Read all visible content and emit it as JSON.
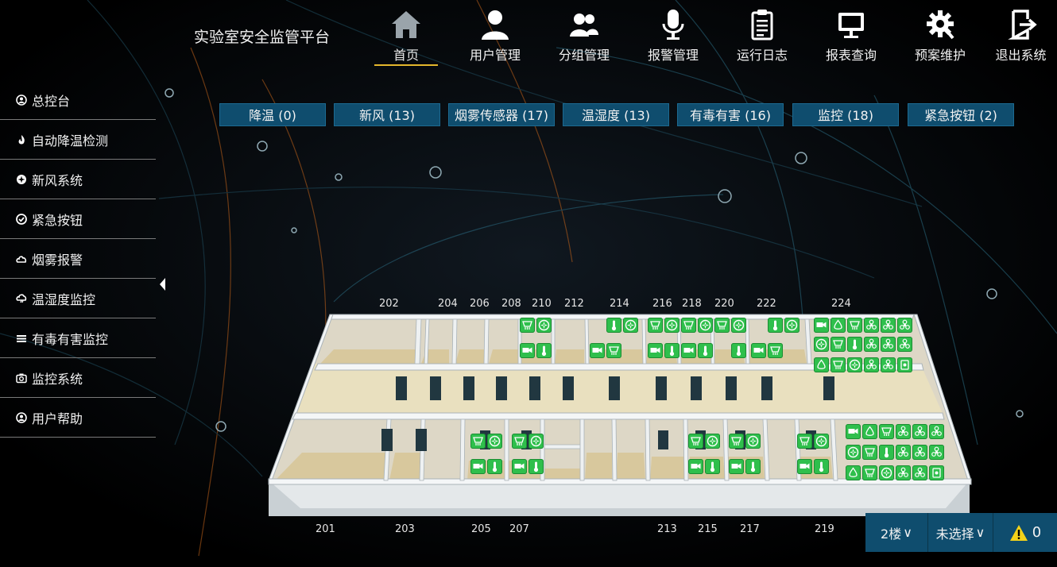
{
  "app": {
    "title": "实验室安全监管平台"
  },
  "nav": [
    {
      "label": "首页",
      "icon": "home-icon",
      "active": true
    },
    {
      "label": "用户管理",
      "icon": "user-icon"
    },
    {
      "label": "分组管理",
      "icon": "group-icon"
    },
    {
      "label": "报警管理",
      "icon": "microphone-icon"
    },
    {
      "label": "运行日志",
      "icon": "clipboard-icon"
    },
    {
      "label": "报表查询",
      "icon": "monitor-icon"
    },
    {
      "label": "预案维护",
      "icon": "gear-icon"
    },
    {
      "label": "退出系统",
      "icon": "exit-icon"
    }
  ],
  "sidebar": [
    {
      "label": "总控台",
      "icon": "dashboard-icon"
    },
    {
      "label": "自动降温检测",
      "icon": "flame-icon"
    },
    {
      "label": "新风系统",
      "icon": "fan-icon"
    },
    {
      "label": "紧急按钮",
      "icon": "check-circle-icon"
    },
    {
      "label": "烟雾报警",
      "icon": "smoke-icon"
    },
    {
      "label": "温湿度监控",
      "icon": "humidity-icon"
    },
    {
      "label": "有毒有害监控",
      "icon": "hazard-lines-icon"
    },
    {
      "label": "监控系统",
      "icon": "camera-icon"
    },
    {
      "label": "用户帮助",
      "icon": "help-icon"
    }
  ],
  "categories": [
    {
      "label": "降温 (0)"
    },
    {
      "label": "新风 (13)"
    },
    {
      "label": "烟雾传感器 (17)"
    },
    {
      "label": "温湿度 (13)"
    },
    {
      "label": "有毒有害 (16)"
    },
    {
      "label": "监控 (18)"
    },
    {
      "label": "紧急按钮 (2)"
    }
  ],
  "rooms_top": [
    "202",
    "204",
    "206",
    "208",
    "210",
    "212",
    "214",
    "216",
    "218",
    "220",
    "222",
    "224"
  ],
  "rooms_bottom": [
    "201",
    "203",
    "205",
    "207",
    "213",
    "215",
    "217",
    "219"
  ],
  "controls": {
    "floor": "2楼",
    "floor_arrow": "∨",
    "selection": "未选择",
    "selection_arrow": "∨",
    "alert_count": "0"
  },
  "colors": {
    "accent": "#e4b72c",
    "button": "#0f4d6e",
    "device": "#2fbf4c"
  }
}
